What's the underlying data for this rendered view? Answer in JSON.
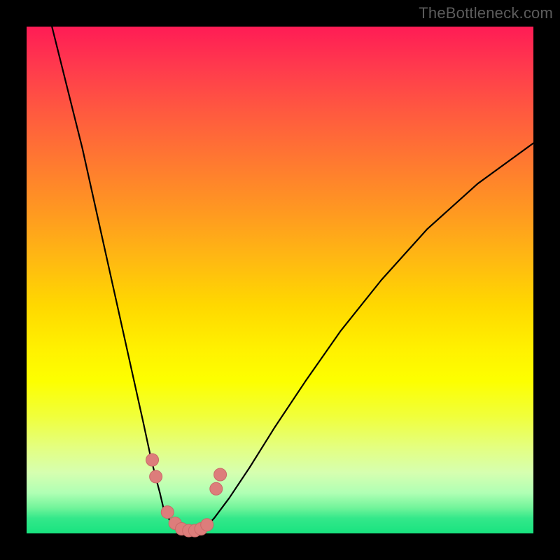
{
  "watermark": "TheBottleneck.com",
  "colors": {
    "frame": "#000000",
    "curve": "#000000",
    "marker_fill": "#dd7d7b",
    "marker_stroke": "#c96a68"
  },
  "chart_data": {
    "type": "line",
    "title": "",
    "xlabel": "",
    "ylabel": "",
    "xlim": [
      0,
      100
    ],
    "ylim": [
      0,
      100
    ],
    "grid": false,
    "legend": false,
    "note": "Axes are unlabeled; values below are estimated from geometry in percentage of the visible plot area (0 = left/bottom, 100 = right/top).",
    "series": [
      {
        "name": "bottleneck-curve-left",
        "stroke": "#000000",
        "x": [
          5,
          7,
          9,
          11,
          13,
          15,
          17,
          19,
          21,
          23,
          24.5,
          25.5,
          26.3,
          27,
          28,
          29,
          30
        ],
        "y": [
          100,
          92,
          84,
          76,
          67,
          58,
          49,
          40,
          31,
          22,
          15,
          11,
          8,
          5,
          3,
          1.5,
          0.8
        ]
      },
      {
        "name": "bottleneck-curve-floor",
        "stroke": "#000000",
        "x": [
          30,
          31,
          32,
          33,
          34,
          35
        ],
        "y": [
          0.8,
          0.5,
          0.4,
          0.4,
          0.5,
          0.8
        ]
      },
      {
        "name": "bottleneck-curve-right",
        "stroke": "#000000",
        "x": [
          35,
          37,
          40,
          44,
          49,
          55,
          62,
          70,
          79,
          89,
          100
        ],
        "y": [
          0.8,
          3,
          7,
          13,
          21,
          30,
          40,
          50,
          60,
          69,
          77
        ]
      }
    ],
    "markers": [
      {
        "x": 24.8,
        "y": 14.5
      },
      {
        "x": 25.5,
        "y": 11.2
      },
      {
        "x": 27.8,
        "y": 4.2
      },
      {
        "x": 29.3,
        "y": 2.0
      },
      {
        "x": 30.6,
        "y": 0.9
      },
      {
        "x": 32.0,
        "y": 0.55
      },
      {
        "x": 33.2,
        "y": 0.55
      },
      {
        "x": 34.4,
        "y": 0.9
      },
      {
        "x": 35.6,
        "y": 1.7
      },
      {
        "x": 37.4,
        "y": 8.8
      },
      {
        "x": 38.2,
        "y": 11.6
      }
    ]
  }
}
